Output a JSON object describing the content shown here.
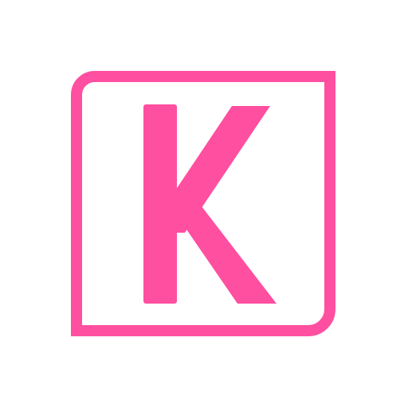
{
  "logo": {
    "letter": "K",
    "color": "#ff4fa0",
    "background": "#ffffff"
  }
}
